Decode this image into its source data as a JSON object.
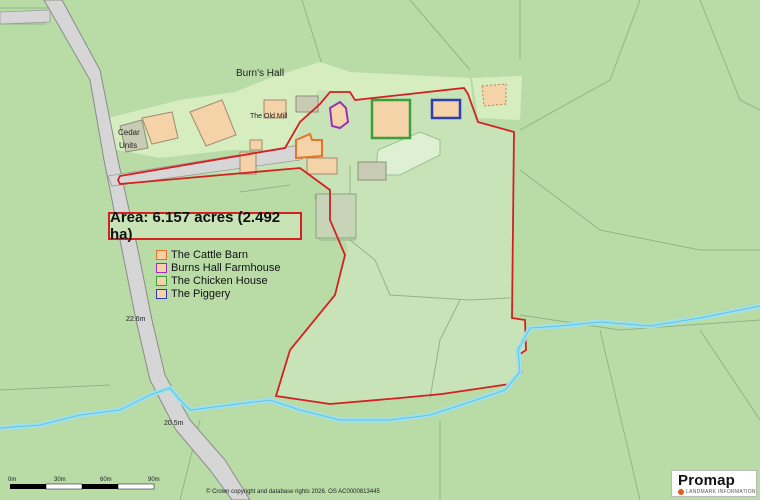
{
  "map": {
    "place_labels": {
      "burns_hall": "Burn's Hall",
      "the_old_mill": "The Old Mill",
      "cedar": "Cedar",
      "units": "Units",
      "spot_height_1": "22.6m",
      "spot_height_2": "20.5m"
    },
    "area_text": "Area: 6.157 acres (2.492 ha)",
    "legend": [
      {
        "label": "The Cattle Barn",
        "color": "#e8742a"
      },
      {
        "label": "Burns Hall Farmhouse",
        "color": "#9b2fb6"
      },
      {
        "label": "The Chicken House",
        "color": "#3aa03a"
      },
      {
        "label": "The Piggery",
        "color": "#2d3fb0"
      }
    ],
    "boundary_color": "#d42020",
    "scale": {
      "ticks": [
        "0m",
        "30m",
        "60m",
        "90m"
      ]
    },
    "copyright": "© Crown copyright and database rights 2026. OS AC0000813445",
    "brand": {
      "name": "Promap",
      "tagline": "LANDMARK INFORMATION"
    }
  }
}
